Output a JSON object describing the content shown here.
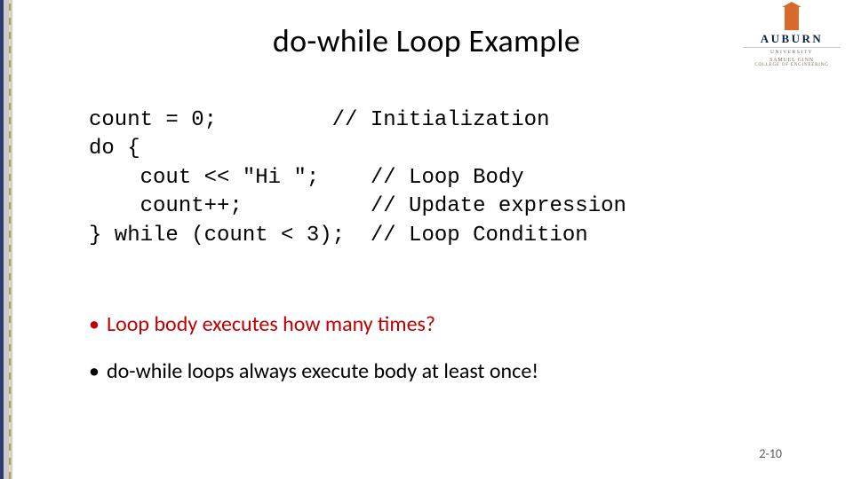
{
  "slide": {
    "title": "do-while Loop Example",
    "page_number": "2-10"
  },
  "logo": {
    "main": "AUBURN",
    "sub": "UNIVERSITY",
    "college1": "SAMUEL GINN",
    "college2": "COLLEGE OF ENGINEERING"
  },
  "code": {
    "l1": "count = 0;         // Initialization",
    "l2": "do {",
    "l3": "    cout << \"Hi \";    // Loop Body",
    "l4": "    count++;          // Update expression",
    "l5": "} while (count < 3);  // Loop Condition"
  },
  "bullets": {
    "b1": "Loop body executes how many times?",
    "b2": "do-while loops always execute body at least once!"
  }
}
